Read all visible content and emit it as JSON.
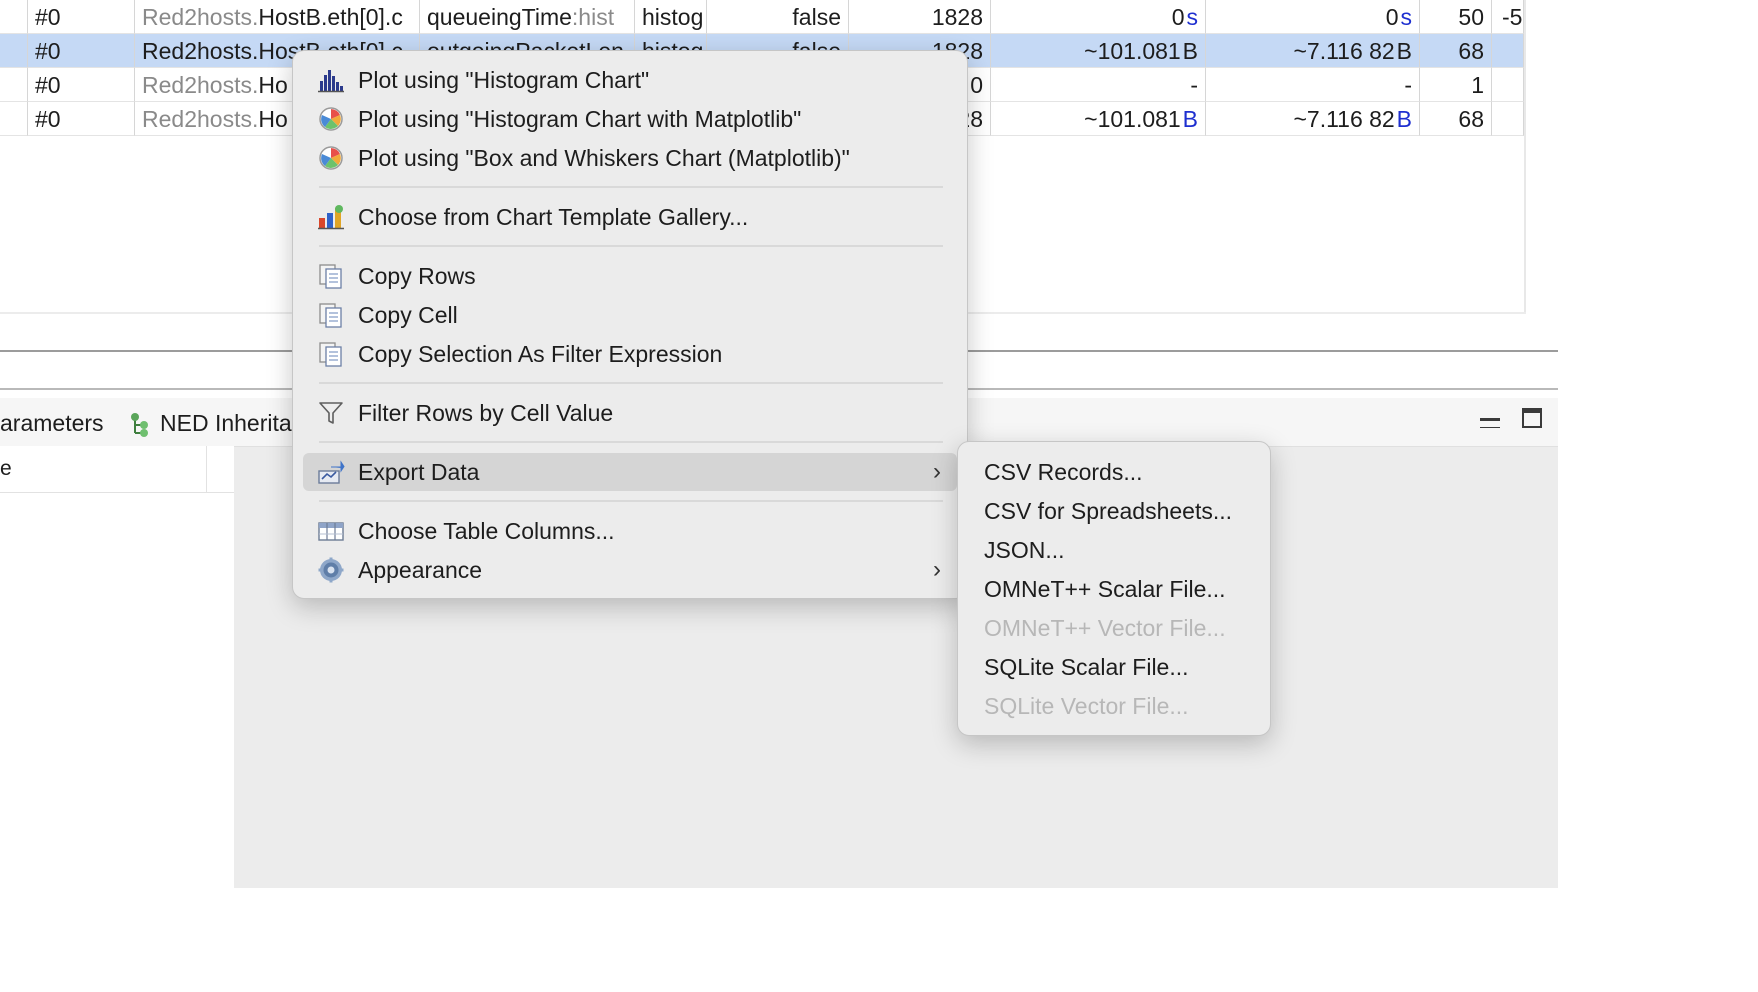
{
  "table": {
    "rows": [
      {
        "run": "#0",
        "module_prefix": "Red2hosts.",
        "module_rest": "HostB.eth[0].c",
        "name": "queueingTime",
        "name_suffix": ":hist",
        "kind": "histog",
        "flag": "false",
        "count": "1828",
        "v1_num": "0",
        "v1_unit": "s",
        "v2_num": "0",
        "v2_unit": "s",
        "bins": "50",
        "extra": "-5",
        "selected": false
      },
      {
        "run": "#0",
        "module_prefix": "Red2hosts.",
        "module_rest": "HostB.eth[0].c",
        "name": "outgoingPacketLen",
        "name_suffix": "",
        "kind": "histog",
        "flag": "false",
        "count": "1828",
        "v1_num": "~101.081",
        "v1_unit": "B",
        "v2_num": "~7.116 82",
        "v2_unit": "B",
        "bins": "68",
        "extra": "",
        "selected": true
      },
      {
        "run": "#0",
        "module_prefix": "Red2hosts.",
        "module_rest": "Ho",
        "name": "",
        "name_suffix": "",
        "kind": "",
        "flag": "",
        "count": "0",
        "v1_num": "-",
        "v1_unit": "",
        "v2_num": "-",
        "v2_unit": "",
        "bins": "1",
        "extra": "",
        "selected": false
      },
      {
        "run": "#0",
        "module_prefix": "Red2hosts.",
        "module_rest": "Ho",
        "name": "",
        "name_suffix": "",
        "kind": "",
        "flag": "",
        "count": "28",
        "v1_num": "~101.081",
        "v1_unit": "B",
        "v2_num": "~7.116 82",
        "v2_unit": "B",
        "bins": "68",
        "extra": "",
        "selected": false
      }
    ]
  },
  "lower": {
    "tabs": [
      {
        "label": "arameters"
      },
      {
        "label": "NED Inherita"
      }
    ],
    "prop_header": "e"
  },
  "context_menu": {
    "items": [
      {
        "label": "Plot using \"Histogram Chart\"",
        "icon": "histogram-chart-icon"
      },
      {
        "label": "Plot using \"Histogram Chart with Matplotlib\"",
        "icon": "matplotlib-icon"
      },
      {
        "label": "Plot using \"Box and Whiskers Chart (Matplotlib)\"",
        "icon": "matplotlib-icon"
      },
      {
        "label": "Choose from Chart Template Gallery...",
        "icon": "chart-gallery-icon"
      },
      {
        "label": "Copy Rows",
        "icon": "copy-icon"
      },
      {
        "label": "Copy Cell",
        "icon": "copy-icon"
      },
      {
        "label": "Copy Selection As Filter Expression",
        "icon": "copy-icon"
      },
      {
        "label": "Filter Rows by Cell Value",
        "icon": "filter-icon"
      },
      {
        "label": "Export Data",
        "icon": "export-icon"
      },
      {
        "label": "Choose Table Columns...",
        "icon": "table-columns-icon"
      },
      {
        "label": "Appearance",
        "icon": "gear-icon"
      }
    ]
  },
  "submenu": {
    "items": [
      {
        "label": "CSV Records...",
        "enabled": true
      },
      {
        "label": "CSV for Spreadsheets...",
        "enabled": true
      },
      {
        "label": "JSON...",
        "enabled": true
      },
      {
        "label": "OMNeT++ Scalar File...",
        "enabled": true
      },
      {
        "label": "OMNeT++ Vector File...",
        "enabled": false
      },
      {
        "label": "SQLite Scalar File...",
        "enabled": true
      },
      {
        "label": "SQLite Vector File...",
        "enabled": false
      }
    ]
  },
  "colors": {
    "selection": "#c5d9f5",
    "unit_blue": "#1e2fd0",
    "menu_bg": "#ececec",
    "menu_highlight": "#d5d5d5",
    "disabled_text": "#b7b7b7"
  }
}
